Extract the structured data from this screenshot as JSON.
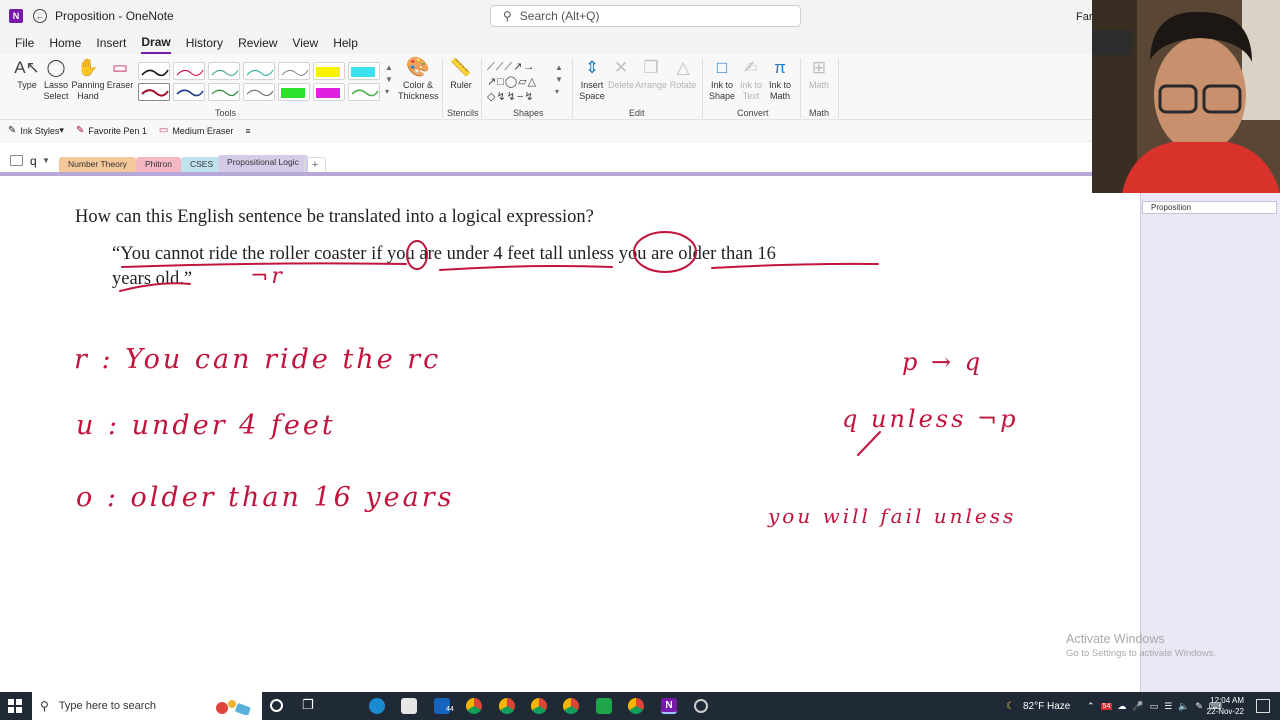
{
  "window": {
    "app_letter": "N",
    "doc_title": "Proposition - OneNote",
    "search_placeholder": "Search (Alt+Q)",
    "user_name": "Farh"
  },
  "menu": [
    "File",
    "Home",
    "Insert",
    "Draw",
    "History",
    "Review",
    "View",
    "Help"
  ],
  "menu_active": "Draw",
  "ribbon": {
    "tools": [
      {
        "label": "Type",
        "icon": "type-cursor-icon"
      },
      {
        "label": "Lasso Select",
        "icon": "lasso-icon"
      },
      {
        "label": "Panning Hand",
        "icon": "hand-icon"
      },
      {
        "label": "Eraser",
        "icon": "eraser-icon"
      }
    ],
    "color_thickness": "Color & Thickness",
    "ruler": "Ruler",
    "insert_space": "Insert Space",
    "delete": "Delete",
    "arrange": "Arrange",
    "rotate": "Rotate",
    "ink_to_shape": "Ink to Shape",
    "ink_to_text": "Ink to Text",
    "ink_to_math": "Ink to Math",
    "math": "Math",
    "groups": [
      "Tools",
      "Stencils",
      "Shapes",
      "Edit",
      "Convert",
      "Math"
    ]
  },
  "pen_toolbar": {
    "ink_styles": "Ink Styles",
    "favorite_pen": "Favorite Pen 1",
    "eraser": "Medium Eraser"
  },
  "notebook": {
    "name": "q",
    "sections": [
      {
        "label": "Number Theory",
        "color": "#f5c89a"
      },
      {
        "label": "Phitron",
        "color": "#f4b8c4"
      },
      {
        "label": "CSES",
        "color": "#bfe3ec"
      },
      {
        "label": "Propositional Logic",
        "color": "#d4cbe9"
      }
    ],
    "add_label": "+"
  },
  "pages": [
    "Proposition"
  ],
  "content": {
    "question": "How can this English sentence be translated into a logical expression?",
    "sentence_line1": "“You cannot ride the roller coaster if you are under 4 feet tall unless you are older than 16",
    "sentence_line2": "years old.”"
  },
  "ink": {
    "note_r": "r : You can ride the rc",
    "note_u": "u : under 4 feet",
    "note_o": "o : older than 16 years",
    "not_r": "¬r",
    "p_implies_q": "p → q",
    "q_unless_not_p": "q unless ¬p",
    "example": "you will fail unless"
  },
  "activate": {
    "title": "Activate Windows",
    "subtitle": "Go to Settings to activate Windows."
  },
  "taskbar": {
    "search_placeholder": "Type here to search",
    "mail_badge": "44",
    "weather": "82°F  Haze",
    "tray_badge": "54",
    "time": "12:04 AM",
    "date": "22-Nov-22"
  }
}
